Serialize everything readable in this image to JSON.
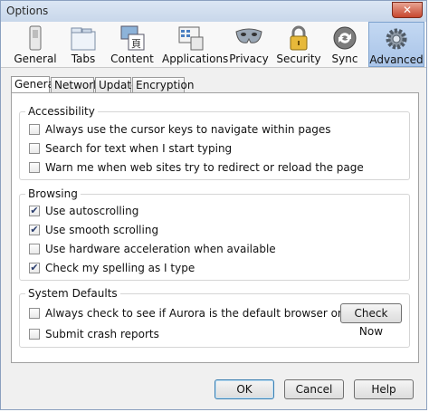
{
  "window": {
    "title": "Options",
    "close_glyph": "✕"
  },
  "toolbar": [
    {
      "label": "General",
      "icon": "general-icon"
    },
    {
      "label": "Tabs",
      "icon": "tabs-icon"
    },
    {
      "label": "Content",
      "icon": "content-icon"
    },
    {
      "label": "Applications",
      "icon": "applications-icon"
    },
    {
      "label": "Privacy",
      "icon": "privacy-icon"
    },
    {
      "label": "Security",
      "icon": "security-icon"
    },
    {
      "label": "Sync",
      "icon": "sync-icon"
    },
    {
      "label": "Advanced",
      "icon": "advanced-icon",
      "active": true
    }
  ],
  "subtabs": [
    {
      "label": "General",
      "selected": true
    },
    {
      "label": "Network"
    },
    {
      "label": "Update"
    },
    {
      "label": "Encryption"
    }
  ],
  "accessibility": {
    "title": "Accessibility",
    "items": [
      {
        "label": "Always use the cursor keys to navigate within pages",
        "checked": false
      },
      {
        "label": "Search for text when I start typing",
        "checked": false
      },
      {
        "label": "Warn me when web sites try to redirect or reload the page",
        "checked": false
      }
    ]
  },
  "browsing": {
    "title": "Browsing",
    "items": [
      {
        "label": "Use autoscrolling",
        "checked": true
      },
      {
        "label": "Use smooth scrolling",
        "checked": true
      },
      {
        "label": "Use hardware acceleration when available",
        "checked": false
      },
      {
        "label": "Check my spelling as I type",
        "checked": true
      }
    ]
  },
  "system_defaults": {
    "title": "System Defaults",
    "items": [
      {
        "label": "Always check to see if Aurora is the default browser on startup",
        "checked": false
      },
      {
        "label": "Submit crash reports",
        "checked": false
      }
    ],
    "check_now": "Check Now"
  },
  "footer": {
    "ok": "OK",
    "cancel": "Cancel",
    "help": "Help"
  },
  "colors": {
    "accent": "#a9c4e8",
    "window_bg": "#f0f0f0"
  }
}
